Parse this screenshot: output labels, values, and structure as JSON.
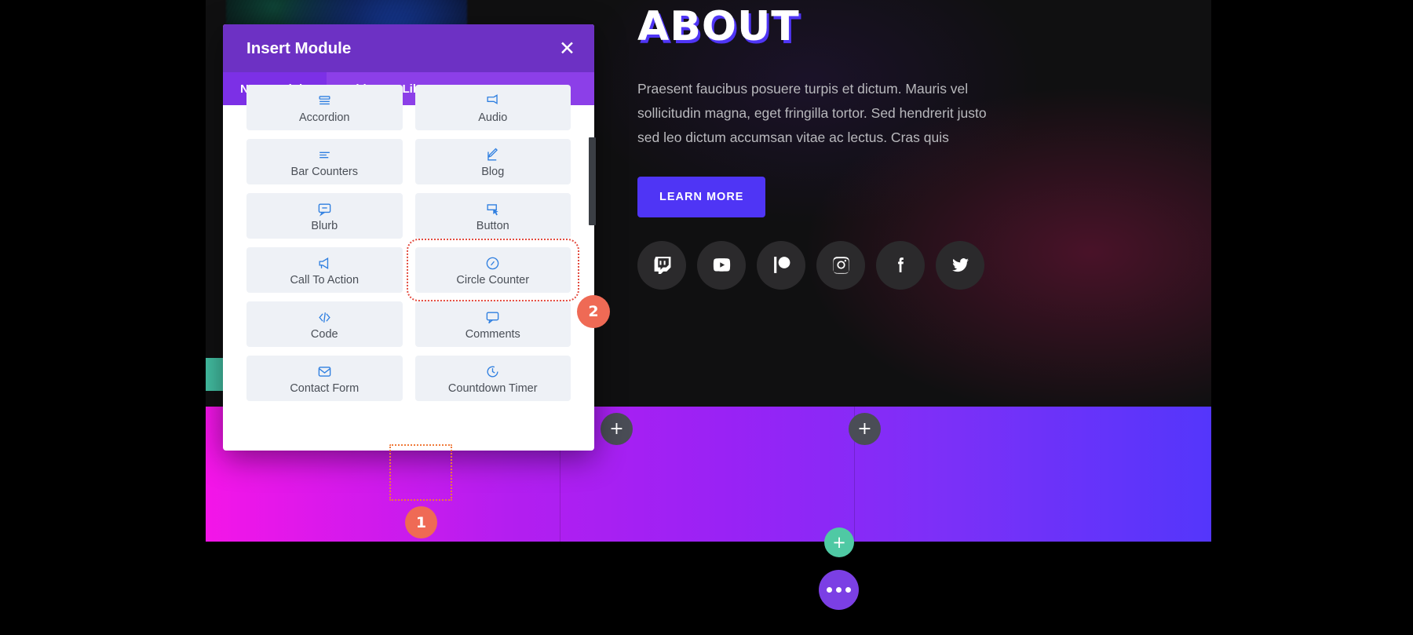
{
  "modal": {
    "title": "Insert Module",
    "close_icon": "close-icon",
    "tabs": [
      {
        "label": "New Module",
        "active": true
      },
      {
        "label": "Add From Library",
        "active": false
      }
    ],
    "modules": [
      {
        "label": "Accordion",
        "icon": "accordion-icon",
        "selected": false
      },
      {
        "label": "Audio",
        "icon": "audio-icon",
        "selected": false
      },
      {
        "label": "Bar Counters",
        "icon": "bar-counters-icon",
        "selected": false
      },
      {
        "label": "Blog",
        "icon": "blog-icon",
        "selected": false
      },
      {
        "label": "Blurb",
        "icon": "blurb-icon",
        "selected": false
      },
      {
        "label": "Button",
        "icon": "button-icon",
        "selected": false
      },
      {
        "label": "Call To Action",
        "icon": "call-to-action-icon",
        "selected": false
      },
      {
        "label": "Circle Counter",
        "icon": "circle-counter-icon",
        "selected": true
      },
      {
        "label": "Code",
        "icon": "code-icon",
        "selected": false
      },
      {
        "label": "Comments",
        "icon": "comments-icon",
        "selected": false
      },
      {
        "label": "Contact Form",
        "icon": "contact-form-icon",
        "selected": false
      },
      {
        "label": "Countdown Timer",
        "icon": "countdown-timer-icon",
        "selected": false
      }
    ]
  },
  "page": {
    "about": {
      "title": "ABOUT",
      "body": "Praesent faucibus posuere turpis et dictum. Mauris vel sollicitudin magna, eget fringilla tortor. Sed hendrerit justo sed leo dictum accumsan vitae ac lectus. Cras quis",
      "cta_label": "LEARN MORE",
      "socials": [
        {
          "name": "twitch-icon"
        },
        {
          "name": "youtube-icon"
        },
        {
          "name": "patreon-icon"
        },
        {
          "name": "instagram-icon"
        },
        {
          "name": "facebook-icon"
        },
        {
          "name": "twitter-icon"
        }
      ]
    },
    "row": {
      "add_module_label": "+",
      "add_section_label": "+",
      "options_icon": "ellipsis-icon"
    }
  },
  "annotations": {
    "step1": "1",
    "step2": "2"
  },
  "colors": {
    "modal_header": "#6d31c4",
    "modal_tabs": "#8c3fe8",
    "accent_button": "#4f35f5",
    "marker": "#ef6a55",
    "highlight": "#e34b3f",
    "add_section": "#4fc9a4",
    "options": "#7b3fe4"
  }
}
